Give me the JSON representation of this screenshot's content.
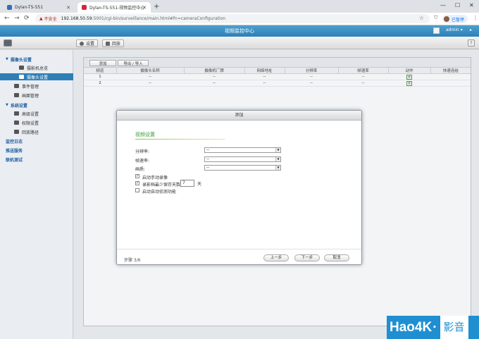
{
  "browser": {
    "tabs": [
      {
        "title": "Dylan-TS-551",
        "favicon_color": "#2f6fb5"
      },
      {
        "title": "Dylan-TS-551-视频监控中心",
        "favicon_color": "#d0283b"
      }
    ],
    "new_tab": "+",
    "window_buttons": [
      "—",
      "☐",
      "✕"
    ],
    "nav": [
      "←",
      "→",
      "⟳"
    ],
    "insecure_label": "不安全",
    "url_host": "192.168.50.59",
    "url_path": ":5001/cgi-bin/surveillance/main.html#fn=cameraConfiguration",
    "bookmark_star": "☆",
    "profile_label": "已暂停",
    "menu": "⋮"
  },
  "app": {
    "title": "视频监控中心",
    "user": "admin ▾",
    "help": "?",
    "toolbar": {
      "settings_label": "设置",
      "playback_label": "回放"
    }
  },
  "sidebar": {
    "groups": [
      {
        "label": "摄像头设置",
        "items": [
          "摄影机总览",
          "摄像头设置",
          "事件管理",
          "画面管理"
        ]
      },
      {
        "label": "系统设置",
        "items": [
          "高级设置",
          "权限设置",
          "回放路径"
        ]
      }
    ],
    "links": [
      "监控日志",
      "推送服务",
      "联机测试"
    ]
  },
  "cameras": {
    "actions": {
      "add": "添加",
      "export_import": "导出 / 导入"
    },
    "columns": [
      "频道",
      "摄像头名称",
      "摄像机厂牌",
      "网络地址",
      "分辨率",
      "帧速率",
      "动作",
      "快速连结"
    ],
    "rows": [
      {
        "channel": "1",
        "name": "--",
        "brand": "--",
        "ip": "--",
        "resolution": "--",
        "fps": "--"
      },
      {
        "channel": "2",
        "name": "--",
        "brand": "--",
        "ip": "--",
        "resolution": "--",
        "fps": "--"
      }
    ]
  },
  "dialog": {
    "title": "添加",
    "section": "视频设置",
    "fields": [
      {
        "label": "分辨率:",
        "value": "--"
      },
      {
        "label": "帧速率:",
        "value": "--"
      },
      {
        "label": "画质:",
        "value": "--"
      }
    ],
    "checks": [
      {
        "label": "启动手动录像",
        "checked": true
      },
      {
        "label": "录影档最少保存天数",
        "checked": true
      },
      {
        "label": "启动自动侦测功能",
        "checked": false
      }
    ],
    "days_value": "7",
    "days_unit": "天",
    "step": "步骤 3/6",
    "buttons": {
      "prev": "上一步",
      "next": "下一步",
      "cancel": "取消"
    }
  },
  "watermark": {
    "brand": "Hao4K",
    "dot": "·",
    "suffix": "影音"
  }
}
